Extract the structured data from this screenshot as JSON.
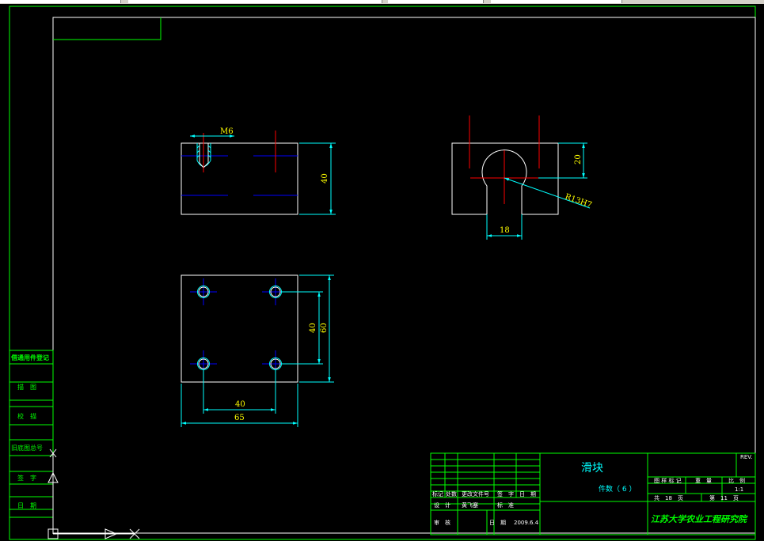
{
  "drawing": {
    "title": "滑块",
    "quantity_label": "件数（ 6 ）",
    "institute": "江苏大学农业工程研究院",
    "rev_label": "REV.",
    "title_block": {
      "stage_label": "图 样 标 记",
      "weight_label": "重　量",
      "scale_label": "比　例",
      "scale_value": "1:1",
      "total_sheets_label": "共　18　页",
      "sheet_label": "第　11　页",
      "marks_label": "标记",
      "count_label": "处数",
      "change_doc_label": "更改文件号",
      "sign_label": "签　字",
      "date_label": "日　期",
      "design_label": "设　计",
      "designer": "黄飞蹇",
      "standard_label": "标　准",
      "review_label": "审　核",
      "date2_label": "日　期",
      "date_value": "2009.6.4"
    },
    "left_strip": {
      "general_parts": "借通用件登记",
      "drawn": "描　图",
      "checked": "校　描",
      "old_drawing_no": "旧底图总号",
      "signature": "签　字",
      "date": "日　期"
    },
    "dimensions": {
      "thread": "M6",
      "front_height": "40",
      "side_height": "20",
      "radius": "R13H7",
      "slot_width": "18",
      "hole_pitch_v": "40",
      "overall_height": "60",
      "hole_pitch_h": "40",
      "overall_width": "65"
    }
  },
  "colors": {
    "background": "#000000",
    "frame": "#00ff00",
    "outline": "#ffffff",
    "dimension": "#00ffff",
    "dim_text": "#ffff00",
    "centerline": "#ff0000",
    "hidden": "#0000ff"
  }
}
